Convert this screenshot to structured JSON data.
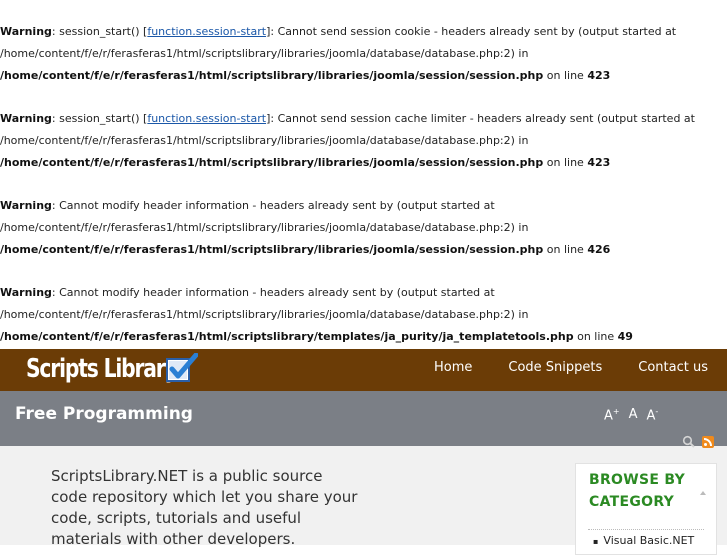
{
  "warnings": [
    {
      "label": "Warning",
      "msg_pre": ": session_start() [",
      "link": "function.session-start",
      "msg_post": "]: Cannot send session cookie - headers already sent by (output started at",
      "path1": "/home/content/f/e/r/ferasferas1/html/scriptslibrary/libraries/joomla/database/database.php:2) in",
      "path2": "/home/content/f/e/r/ferasferas1/html/scriptslibrary/libraries/joomla/session/session.php",
      "online": " on line ",
      "line": "423"
    },
    {
      "label": "Warning",
      "msg_pre": ": session_start() [",
      "link": "function.session-start",
      "msg_post": "]: Cannot send session cache limiter - headers already sent (output started at",
      "path1": "/home/content/f/e/r/ferasferas1/html/scriptslibrary/libraries/joomla/database/database.php:2) in",
      "path2": "/home/content/f/e/r/ferasferas1/html/scriptslibrary/libraries/joomla/session/session.php",
      "online": " on line ",
      "line": "423"
    },
    {
      "label": "Warning",
      "msg": ": Cannot modify header information - headers already sent by (output started at",
      "path1": "/home/content/f/e/r/ferasferas1/html/scriptslibrary/libraries/joomla/database/database.php:2) in",
      "path2": "/home/content/f/e/r/ferasferas1/html/scriptslibrary/libraries/joomla/session/session.php",
      "online": " on line ",
      "line": "426"
    },
    {
      "label": "Warning",
      "msg": ": Cannot modify header information - headers already sent by (output started at",
      "path1": "/home/content/f/e/r/ferasferas1/html/scriptslibrary/libraries/joomla/database/database.php:2) in",
      "path2": "/home/content/f/e/r/ferasferas1/html/scriptslibrary/templates/ja_purity/ja_templatetools.php",
      "online": " on line ",
      "line": "49"
    }
  ],
  "header": {
    "logo_text": "Scripts Library",
    "nav": [
      "Home",
      "Code Snippets",
      "Contact us"
    ]
  },
  "band": {
    "title": "Free Programming",
    "font_increase": "A",
    "font_default": "A",
    "font_decrease": "A",
    "sup_plus": "+",
    "sup_minus": "-"
  },
  "main": {
    "intro": "ScriptsLibrary.NET is a public source code repository which let you share your code, scripts, tutorials and useful materials with other developers."
  },
  "sidebar": {
    "title_line1": "BROWSE BY",
    "title_line2": "CATEGORY",
    "items": [
      "Visual Basic.NET"
    ]
  },
  "colors": {
    "header_bg": "#6b3c06",
    "band_bg": "#7b7f86",
    "sidebar_title": "#2b8a23",
    "link": "#1a57a8"
  },
  "icons": [
    "checkbox-check-icon",
    "search-icon",
    "rss-icon",
    "collapse-arrow-icon"
  ]
}
